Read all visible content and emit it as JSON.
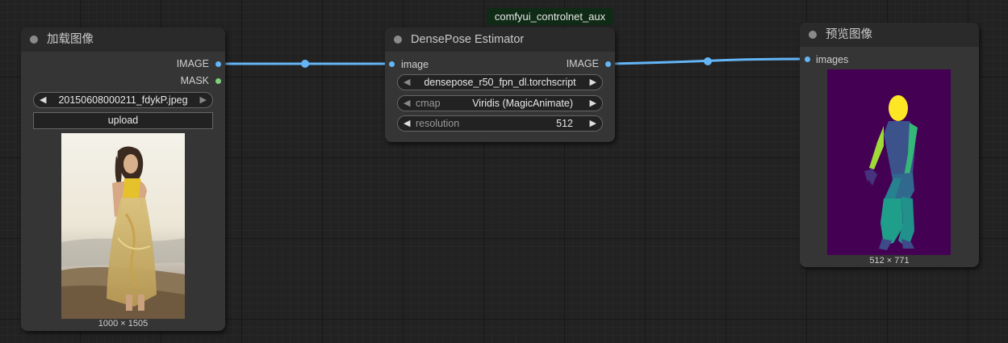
{
  "colors": {
    "link": "#64b5f6",
    "image_slot": "#64b5f6",
    "mask_slot": "#7fd17f",
    "node_body": "#353535",
    "node_title": "#2a2a2a",
    "badge_bg": "#0f2a15"
  },
  "badge": {
    "text": "comfyui_controlnet_aux"
  },
  "load_node": {
    "title": "加载图像",
    "outputs": [
      "IMAGE",
      "MASK"
    ],
    "image_widget": {
      "value": "20150608000211_fdykP.jpeg"
    },
    "upload_label": "upload",
    "preview_icon": "photo-woman-beach",
    "dimensions": "1000 × 1505"
  },
  "dense_node": {
    "title": "DensePose Estimator",
    "input": "image",
    "output": "IMAGE",
    "model": {
      "value": "densepose_r50_fpn_dl.torchscript"
    },
    "cmap": {
      "name": "cmap",
      "value": "Viridis (MagicAnimate)"
    },
    "resolution": {
      "name": "resolution",
      "value": "512"
    }
  },
  "preview_node": {
    "title": "预览图像",
    "input": "images",
    "preview_icon": "densepose-figure",
    "dimensions": "512 × 771"
  }
}
